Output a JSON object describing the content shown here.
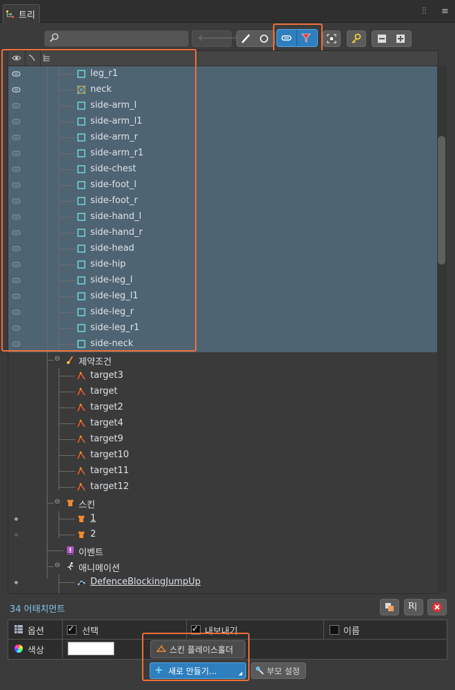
{
  "tab": {
    "title": "트리"
  },
  "tree_rows": [
    {
      "label": "leg_r1",
      "type": "attachment",
      "vis": "on"
    },
    {
      "label": "neck",
      "type": "mesh",
      "vis": "on"
    },
    {
      "label": "side-arm_l",
      "type": "attachment",
      "vis": "dim"
    },
    {
      "label": "side-arm_l1",
      "type": "attachment",
      "vis": "dim"
    },
    {
      "label": "side-arm_r",
      "type": "attachment",
      "vis": "dim"
    },
    {
      "label": "side-arm_r1",
      "type": "attachment",
      "vis": "dim"
    },
    {
      "label": "side-chest",
      "type": "attachment",
      "vis": "dim"
    },
    {
      "label": "side-foot_l",
      "type": "attachment",
      "vis": "dim"
    },
    {
      "label": "side-foot_r",
      "type": "attachment",
      "vis": "dim"
    },
    {
      "label": "side-hand_l",
      "type": "attachment",
      "vis": "dim"
    },
    {
      "label": "side-hand_r",
      "type": "attachment",
      "vis": "dim"
    },
    {
      "label": "side-head",
      "type": "attachment",
      "vis": "dim"
    },
    {
      "label": "side-hip",
      "type": "attachment",
      "vis": "dim"
    },
    {
      "label": "side-leg_l",
      "type": "attachment",
      "vis": "dim"
    },
    {
      "label": "side-leg_l1",
      "type": "attachment",
      "vis": "dim"
    },
    {
      "label": "side-leg_r",
      "type": "attachment",
      "vis": "dim"
    },
    {
      "label": "side-leg_r1",
      "type": "attachment",
      "vis": "dim"
    },
    {
      "label": "side-neck",
      "type": "attachment",
      "vis": "dim"
    }
  ],
  "constraints": {
    "label": "제약조건",
    "items": [
      "target3",
      "target",
      "target2",
      "target4",
      "target9",
      "target10",
      "target11",
      "target12"
    ]
  },
  "skins": {
    "label": "스킨",
    "items": [
      "1",
      "2"
    ]
  },
  "events": {
    "label": "이벤트"
  },
  "animations": {
    "label": "애니메이션",
    "items": [
      "DefenceBlockingJumpUp"
    ]
  },
  "footer": {
    "count": "34 어태치먼트",
    "props": {
      "options_label": "옵션",
      "select_label": "선택",
      "export_label": "내보내기",
      "name_label": "이름",
      "color_label": "색상"
    },
    "popup": {
      "skin_placeholder": "스킨 플레이스홀더",
      "new_label": "새로 만들기...",
      "parent_label": "부모 설정"
    }
  },
  "colors": {
    "accent_highlight": "#f0703a",
    "selected_row_bg": "#4f6473",
    "button_selected": "#2f7fbf"
  }
}
